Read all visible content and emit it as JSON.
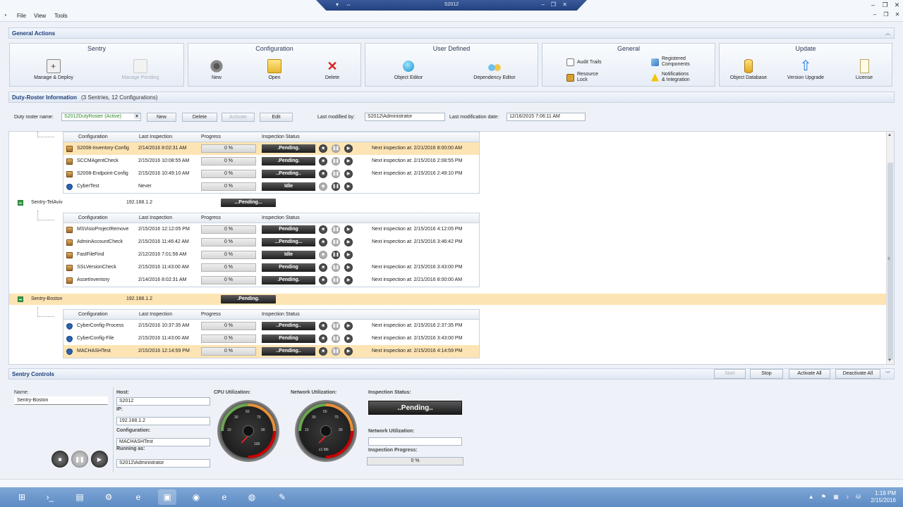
{
  "window": {
    "title": "S2012"
  },
  "menu": {
    "file": "File",
    "view": "View",
    "tools": "Tools"
  },
  "general_actions": {
    "title": "General Actions",
    "groups": {
      "sentry": {
        "title": "Sentry",
        "manage_deploy": "Manage & Deploy",
        "manage_pending": "Manage Pending"
      },
      "configuration": {
        "title": "Configuration",
        "new": "New",
        "open": "Open",
        "delete": "Delete"
      },
      "user_defined": {
        "title": "User Defined",
        "object_editor": "Object Editor",
        "dependency_editor": "Dependency Editor"
      },
      "general": {
        "title": "General",
        "audit_trails": "Audit Trails",
        "resource_lock": "Resource\nLock",
        "registered_components": "Registered\nComponents",
        "notifications": "Notifications\n& Integration"
      },
      "update": {
        "title": "Update",
        "object_database": "Object Database",
        "version_upgrade": "Version Upgrade",
        "license": "License"
      }
    }
  },
  "duty_roster": {
    "title": "Duty-Roster Information",
    "subtitle": "(3 Sentries, 12 Configurations)",
    "name_label": "Duty roster name:",
    "name_value": "S2012DutyRoster (Active)",
    "new_btn": "New",
    "delete_btn": "Delete",
    "activate_btn": "Activate",
    "edit_btn": "Edit",
    "modified_by_label": "Last modified by:",
    "modified_by_value": "S2012\\Administrator",
    "modified_date_label": "Last modification date:",
    "modified_date_value": "12/16/2015 7:06:11 AM"
  },
  "columns": {
    "configuration": "Configuration",
    "last_inspection": "Last Inspection",
    "progress": "Progress",
    "inspection_status": "Inspection Status"
  },
  "group1_rows": [
    {
      "icon": "box",
      "name": "S2008-Inventory-Config",
      "last": "2/14/2016 8:02:31 AM",
      "progress": "0 %",
      "status": ".Pending.",
      "next": "Next inspection at: 2/21/2016 8:00:00 AM",
      "selected": true
    },
    {
      "icon": "box",
      "name": "SCCMAgentCheck",
      "last": "2/15/2016 10:08:55 AM",
      "progress": "0 %",
      "status": ".Pending.",
      "next": "Next inspection at: 2/15/2016 2:08:55 PM",
      "selected": false
    },
    {
      "icon": "box",
      "name": "S2008-Endpoint-Config",
      "last": "2/15/2016 10:49:10 AM",
      "progress": "0 %",
      "status": "..Pending..",
      "next": "Next inspection at: 2/15/2016 2:49:10 PM",
      "selected": false
    },
    {
      "icon": "shield",
      "name": "CyberTest",
      "last": "Never",
      "progress": "0 %",
      "status": "Idle",
      "next": "",
      "selected": false
    }
  ],
  "sentries": [
    {
      "name": "Sentry-TelAviv",
      "ip": "192.168.1.2",
      "status": "...Pending...",
      "selected": false
    },
    {
      "name": "Sentry-Boston",
      "ip": "192.168.1.2",
      "status": ".Pending.",
      "selected": true
    }
  ],
  "group2_rows": [
    {
      "icon": "box",
      "name": "MSVisioProjectRemove",
      "last": "2/15/2016 12:12:05 PM",
      "progress": "0 %",
      "status": "Pending",
      "next": "Next inspection at: 2/15/2016 4:12:05 PM"
    },
    {
      "icon": "box",
      "name": "AdminAccountCheck",
      "last": "2/15/2016 11:46:42 AM",
      "progress": "0 %",
      "status": "...Pending...",
      "next": "Next inspection at: 2/15/2016 3:46:42 PM"
    },
    {
      "icon": "box",
      "name": "FastFileFind",
      "last": "2/12/2016 7:01:56 AM",
      "progress": "0 %",
      "status": "Idle",
      "next": ""
    },
    {
      "icon": "box",
      "name": "SSLVersionCheck",
      "last": "2/15/2016 11:43:00 AM",
      "progress": "0 %",
      "status": "Pending",
      "next": "Next inspection at: 2/15/2016 3:43:00 PM"
    },
    {
      "icon": "box",
      "name": "AssetInventory",
      "last": "2/14/2016 8:02:31 AM",
      "progress": "0 %",
      "status": ".Pending.",
      "next": "Next inspection at: 2/21/2016 8:00:00 AM"
    }
  ],
  "group3_rows": [
    {
      "icon": "shield",
      "name": "CyberConfig-Process",
      "last": "2/15/2016 10:37:35 AM",
      "progress": "0 %",
      "status": "..Pending..",
      "next": "Next inspection at: 2/15/2016 2:37:35 PM",
      "selected": false
    },
    {
      "icon": "shield",
      "name": "CyberConfig-File",
      "last": "2/15/2016 11:43:00 AM",
      "progress": "0 %",
      "status": "Pending",
      "next": "Next inspection at: 2/15/2016 3:43:00 PM",
      "selected": false
    },
    {
      "icon": "shield",
      "name": "MACHASHTest",
      "last": "2/15/2016 12:14:59 PM",
      "progress": "0 %",
      "status": "..Pending..",
      "next": "Next inspection at: 2/15/2016 4:14:59 PM",
      "selected": true
    }
  ],
  "sentry_controls": {
    "title": "Sentry Controls",
    "start": "Start",
    "stop": "Stop",
    "activate_all": "Activate All",
    "deactivate_all": "Deactivate All",
    "name_label": "Name:",
    "name_value": "Sentry-Boston",
    "host_label": "Host:",
    "host_value": "S2012",
    "ip_label": "IP:",
    "ip_value": "192.168.1.2",
    "configuration_label": "Configuration:",
    "configuration_value": "MACHASHTest",
    "running_as_label": "Running as:",
    "running_as_value": "S2012\\Administrator",
    "cpu_label": "CPU Utilization:",
    "network_label": "Network Utilization:",
    "inspection_status_label": "Inspection Status:",
    "inspection_status_value": "..Pending..",
    "network_util_label": "Network Utilization:",
    "inspection_progress_label": "Inspection Progress:",
    "inspection_progress_value": "0 %",
    "net_gauge_unit": "x1 Mb"
  },
  "taskbar": {
    "time": "1:19 PM",
    "date": "2/15/2016"
  },
  "colors": {
    "selection": "#fde4b4",
    "header_text": "#1c3f7a",
    "status_bg": "#1e1e1e"
  }
}
